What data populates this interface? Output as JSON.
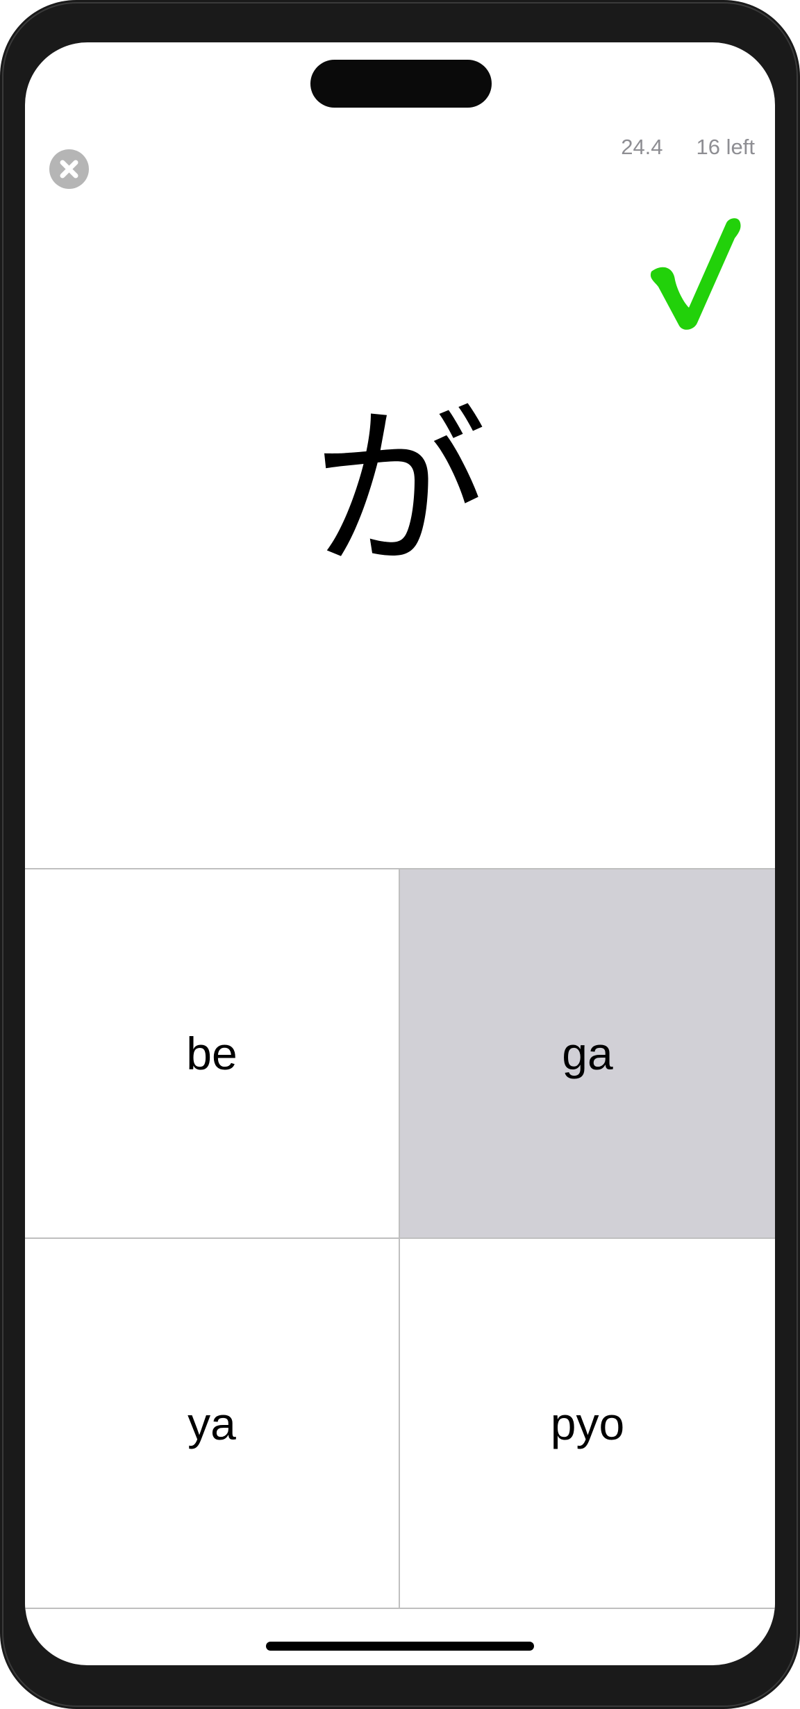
{
  "header": {
    "close_icon": "close-circle-icon",
    "time": "24.4",
    "remaining": "16 left"
  },
  "feedback": {
    "icon": "checkmark-icon",
    "color": "#22d10a"
  },
  "question": {
    "character": "が"
  },
  "answers": [
    {
      "label": "be",
      "selected": false
    },
    {
      "label": "ga",
      "selected": true
    },
    {
      "label": "ya",
      "selected": false
    },
    {
      "label": "pyo",
      "selected": false
    }
  ],
  "colors": {
    "selected_background": "#d1d0d6",
    "divider": "#bfbfbf",
    "stats_text": "#8e8e93"
  }
}
